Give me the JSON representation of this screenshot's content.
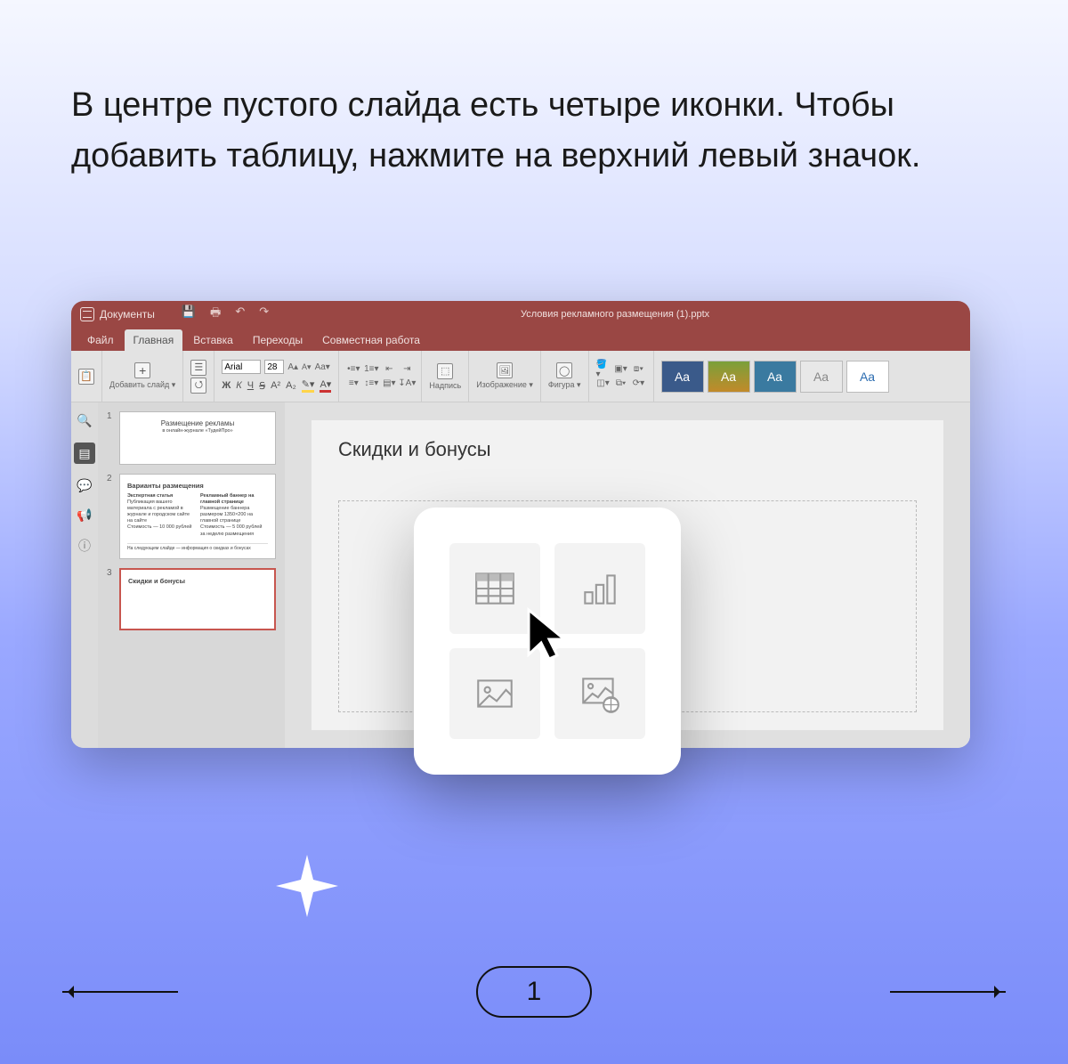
{
  "instruction": "В центре пустого слайда есть четыре иконки. Чтобы добавить таблицу, нажмите на верхний левый значок.",
  "titlebar": {
    "app_label": "Документы",
    "doc_title": "Условия рекламного размещения (1).pptx"
  },
  "menu": {
    "file": "Файл",
    "home": "Главная",
    "insert": "Вставка",
    "transitions": "Переходы",
    "collab": "Совместная работа"
  },
  "ribbon": {
    "add_slide": "Добавить слайд ▾",
    "font_name": "Arial",
    "font_size": "28",
    "textbox": "Надпись",
    "image": "Изображение ▾",
    "shape": "Фигура ▾"
  },
  "themes": [
    "Aa",
    "Aa",
    "Aa",
    "Aa",
    "Aa"
  ],
  "thumbs": [
    {
      "num": "1",
      "title": "Размещение рекламы",
      "sub": "в онлайн-журнале «ТудейПро»"
    },
    {
      "num": "2",
      "title": "Варианты размещения",
      "col1h": "Экспертная статья",
      "col1": "Публикация вашего материала с рекламой в журнале и городском сайте на сайте",
      "col1p": "Стоимость — 10 000 рублей",
      "col2h": "Рекламный баннер на главной странице",
      "col2": "Размещение баннера размером 1350×200 на главной странице",
      "col2p": "Стоимость — 5 000 рублей за неделю размещения",
      "foot": "На следующем слайде — информация о скидках и бонусах"
    },
    {
      "num": "3",
      "title": "Скидки и бонусы"
    }
  ],
  "canvas": {
    "title": "Скидки и бонусы"
  },
  "popup": {
    "table": "insert-table",
    "chart": "insert-chart",
    "image": "insert-image",
    "web_image": "insert-online-image"
  },
  "nav": {
    "page": "1"
  }
}
